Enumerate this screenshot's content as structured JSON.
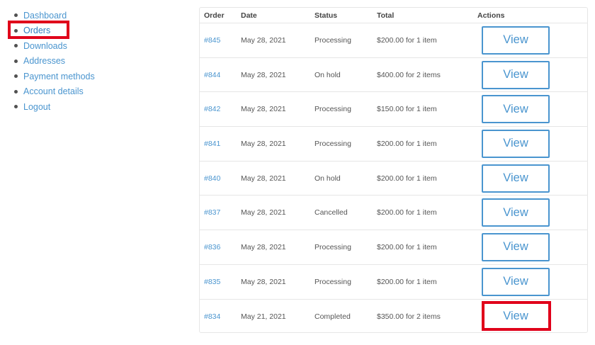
{
  "nav": {
    "items": [
      {
        "label": "Dashboard"
      },
      {
        "label": "Orders"
      },
      {
        "label": "Downloads"
      },
      {
        "label": "Addresses"
      },
      {
        "label": "Payment methods"
      },
      {
        "label": "Account details"
      },
      {
        "label": "Logout"
      }
    ],
    "active_index": 1
  },
  "orders": {
    "headers": {
      "order": "Order",
      "date": "Date",
      "status": "Status",
      "total": "Total",
      "actions": "Actions"
    },
    "rows": [
      {
        "order": "#845",
        "date": "May 28, 2021",
        "status": "Processing",
        "total": "$200.00 for 1 item",
        "action": "View"
      },
      {
        "order": "#844",
        "date": "May 28, 2021",
        "status": "On hold",
        "total": "$400.00 for 2 items",
        "action": "View"
      },
      {
        "order": "#842",
        "date": "May 28, 2021",
        "status": "Processing",
        "total": "$150.00 for 1 item",
        "action": "View"
      },
      {
        "order": "#841",
        "date": "May 28, 2021",
        "status": "Processing",
        "total": "$200.00 for 1 item",
        "action": "View"
      },
      {
        "order": "#840",
        "date": "May 28, 2021",
        "status": "On hold",
        "total": "$200.00 for 1 item",
        "action": "View"
      },
      {
        "order": "#837",
        "date": "May 28, 2021",
        "status": "Cancelled",
        "total": "$200.00 for 1 item",
        "action": "View"
      },
      {
        "order": "#836",
        "date": "May 28, 2021",
        "status": "Processing",
        "total": "$200.00 for 1 item",
        "action": "View"
      },
      {
        "order": "#835",
        "date": "May 28, 2021",
        "status": "Processing",
        "total": "$200.00 for 1 item",
        "action": "View"
      },
      {
        "order": "#834",
        "date": "May 21, 2021",
        "status": "Completed",
        "total": "$350.00 for 2 items",
        "action": "View"
      }
    ]
  },
  "colors": {
    "link": "#4a95cf",
    "highlight": "#e0001a",
    "border": "#e6e6e6"
  }
}
